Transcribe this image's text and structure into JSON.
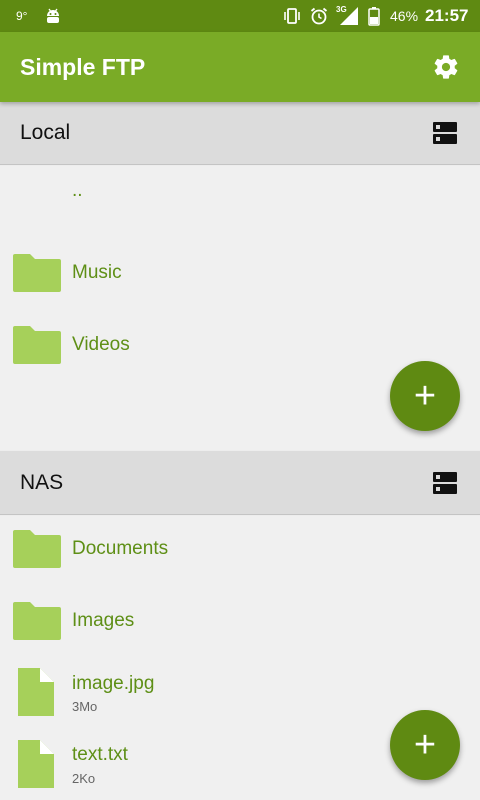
{
  "status_bar": {
    "left_icons": [
      "temperature-icon",
      "android-debug-icon"
    ],
    "temperature": "9°",
    "right_icons": [
      "vibrate-icon",
      "alarm-icon",
      "signal-3g-icon",
      "battery-icon"
    ],
    "network": "3G",
    "battery": "46%",
    "time": "21:57"
  },
  "app_bar": {
    "title": "Simple FTP",
    "settings_icon": "gear-icon"
  },
  "local": {
    "header": "Local",
    "header_icon": "server-icon",
    "items": [
      {
        "name": "..",
        "type": "parent"
      },
      {
        "name": "Music",
        "type": "folder"
      },
      {
        "name": "Videos",
        "type": "folder"
      }
    ],
    "fab": "+"
  },
  "nas": {
    "header": "NAS",
    "header_icon": "server-icon",
    "items": [
      {
        "name": "Documents",
        "type": "folder"
      },
      {
        "name": "Images",
        "type": "folder"
      },
      {
        "name": "image.jpg",
        "type": "file",
        "size": "3Mo"
      },
      {
        "name": "text.txt",
        "type": "file",
        "size": "2Ko"
      }
    ],
    "fab": "+"
  },
  "colors": {
    "status_bar": "#5f8a12",
    "app_bar": "#7aab26",
    "accent_text": "#5e8f16",
    "folder": "#a6d05a",
    "fab": "#5f8a12"
  }
}
